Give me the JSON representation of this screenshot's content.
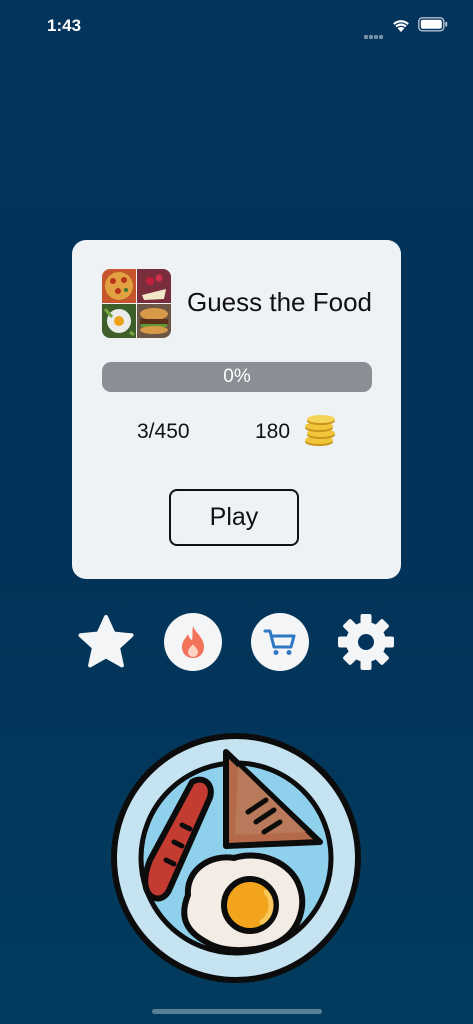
{
  "status_bar": {
    "time": "1:43"
  },
  "game": {
    "title": "Guess the Food",
    "progress_label": "0%",
    "progress_fraction": 0.0,
    "levels": "3/450",
    "coins": "180",
    "play_label": "Play"
  },
  "actions": [
    {
      "name": "favorites",
      "icon": "star-icon"
    },
    {
      "name": "trending",
      "icon": "fire-icon"
    },
    {
      "name": "shop",
      "icon": "cart-icon"
    },
    {
      "name": "settings",
      "icon": "gear-icon"
    }
  ],
  "colors": {
    "background": "#04335c",
    "card": "#eff2f5",
    "progress_track": "#8a8f95",
    "fire": "#f2735a",
    "cart": "#2f78c4"
  }
}
